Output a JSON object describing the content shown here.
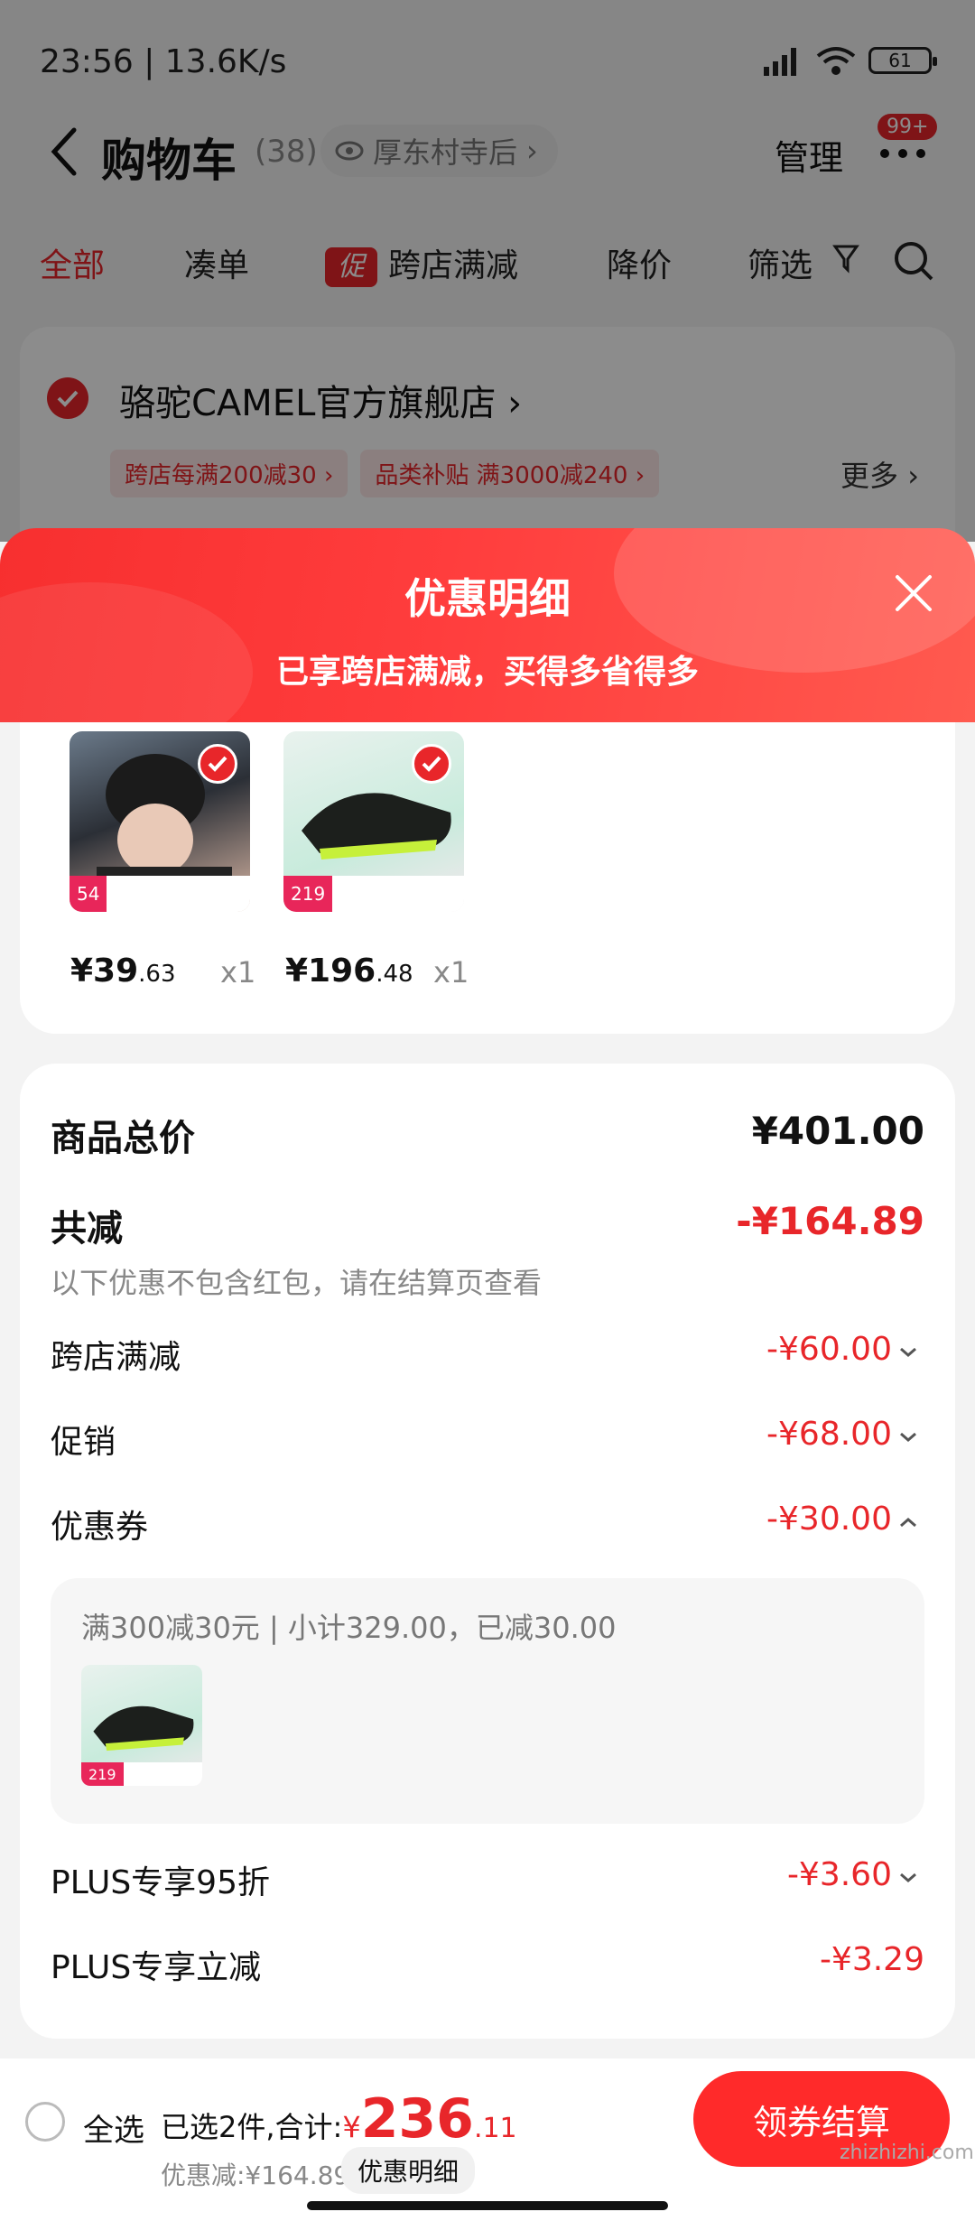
{
  "status_bar": {
    "time": "23:56 | 13.6K/s",
    "battery": "61"
  },
  "nav": {
    "title": "购物车",
    "count": "(38)",
    "location": "厚东村寺后",
    "manage": "管理",
    "badge": "99+"
  },
  "tabs": [
    {
      "label": "全部",
      "active": true
    },
    {
      "label": "凑单"
    },
    {
      "label": "跨店满减",
      "mark": "促"
    },
    {
      "label": "降价"
    },
    {
      "label": "筛选"
    }
  ],
  "store": {
    "name": "骆驼CAMEL官方旗舰店",
    "tags": [
      "跨店每满200减30",
      "品类补贴 满3000减240"
    ],
    "more": "更多"
  },
  "sheet": {
    "title": "优惠明细",
    "subtitle": "已享跨店满减，买得多省得多"
  },
  "products": [
    {
      "price_int": "¥39",
      "price_cents": ".63",
      "qty": "x1",
      "tag_price": "54"
    },
    {
      "price_int": "¥196",
      "price_cents": ".48",
      "qty": "x1",
      "tag_price": "219"
    }
  ],
  "summary": {
    "total_label": "商品总价",
    "total_value": "¥401.00",
    "reduce_label": "共减",
    "reduce_value": "-¥164.89",
    "hint": "以下优惠不包含红包，请在结算页查看",
    "rows": [
      {
        "label": "跨店满减",
        "value": "-¥60.00"
      },
      {
        "label": "促销",
        "value": "-¥68.00"
      },
      {
        "label": "优惠券",
        "value": "-¥30.00"
      },
      {
        "label": "PLUS专享95折",
        "value": "-¥3.60"
      },
      {
        "label": "PLUS专享立减",
        "value": "-¥3.29"
      }
    ],
    "coupon_detail": "满300减30元 | 小计329.00，已减30.00",
    "coupon_thumb_price": "219"
  },
  "bottom": {
    "select_all": "全选",
    "selected_text": "已选2件,合计:",
    "currency": "¥",
    "total_int": "236",
    "total_dec": ".11",
    "discount_text": "优惠减:¥164.89",
    "detail_button": "优惠明细",
    "checkout": "领券结算"
  },
  "watermark": "zhizhizhi.com",
  "colors": {
    "accent": "#e8262a",
    "sheet_header": "#ff3d3d"
  }
}
